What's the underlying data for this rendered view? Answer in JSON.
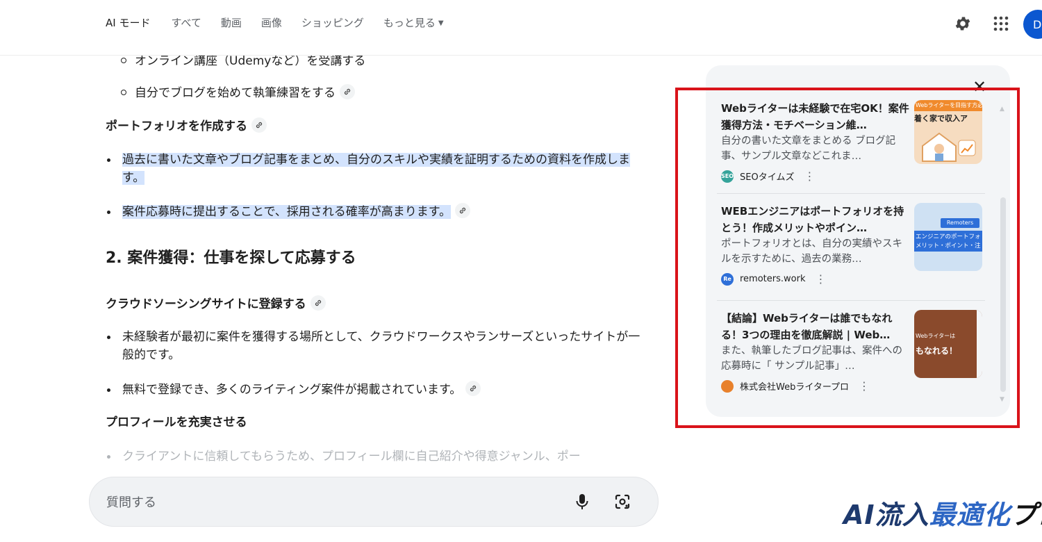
{
  "nav": {
    "tabs": [
      "AI モード",
      "すべて",
      "動画",
      "画像",
      "ショッピング",
      "もっと見る"
    ],
    "avatar_letter": "D"
  },
  "answer": {
    "sub_items": [
      "オンライン講座（Udemyなど）を受講する",
      "自分でブログを始めて執筆練習をする"
    ],
    "portfolio_heading": "ポートフォリオを作成する",
    "portfolio_bullets": [
      "過去に書いた文章やブログ記事をまとめ、自分のスキルや実績を証明するための資料を作成します。",
      "案件応募時に提出することで、採用される確率が高まります。"
    ],
    "section2_title": "2. 案件獲得：仕事を探して応募する",
    "crowd_heading": "クラウドソーシングサイトに登録する",
    "crowd_bullets": [
      "未経験者が最初に案件を獲得する場所として、クラウドワークスやランサーズといったサイトが一般的です。",
      "無料で登録でき、多くのライティング案件が掲載されています。"
    ],
    "profile_heading": "プロフィールを充実させる",
    "profile_bullet": "クライアントに信頼してもらうため、プロフィール欄に自己紹介や得意ジャンル、ポー"
  },
  "ask": {
    "placeholder": "質問する"
  },
  "sources": {
    "cards": [
      {
        "title": "Webライターは未経験で在宅OK！案件獲得方法・モチベーション維…",
        "snippet": "自分の書いた文章をまとめる ブログ記事、サンプル文章などこれま…",
        "source": "SEOタイムズ",
        "favicon_text": "SEO",
        "favicon_color": "#34a39a",
        "thumb_top": "Webライターを目指す方必見",
        "thumb_main": "着く家で収入ア"
      },
      {
        "title": "WEBエンジニアはポートフォリオを持とう！作成メリットやポイン…",
        "snippet": "ポートフォリオとは、自分の実績やスキルを示すために、過去の業務…",
        "source": "remoters.work",
        "favicon_text": "Re",
        "favicon_color": "#2e6fd8",
        "thumb_top": "Remoters",
        "thumb_main": "エンジニアのポートフォ",
        "thumb_sub": "メリット・ポイント・注"
      },
      {
        "title": "【結論】Webライターは誰でもなれる！3つの理由を徹底解説 | Web…",
        "snippet": "また、執筆したブログ記事は、案件への応募時に「 サンプル記事」…",
        "source": "株式会社Webライタープロ",
        "favicon_text": "",
        "favicon_color": "#e8812c",
        "thumb_top": "Webライターは",
        "thumb_main": "もなれる！"
      }
    ]
  },
  "logo": {
    "part1": "AI流入",
    "part2": "最適化",
    "part3": "プロ"
  },
  "colors": {
    "highlight": "#d3e3fd",
    "redbox": "#d9131a",
    "accent": "#0b57d0"
  }
}
